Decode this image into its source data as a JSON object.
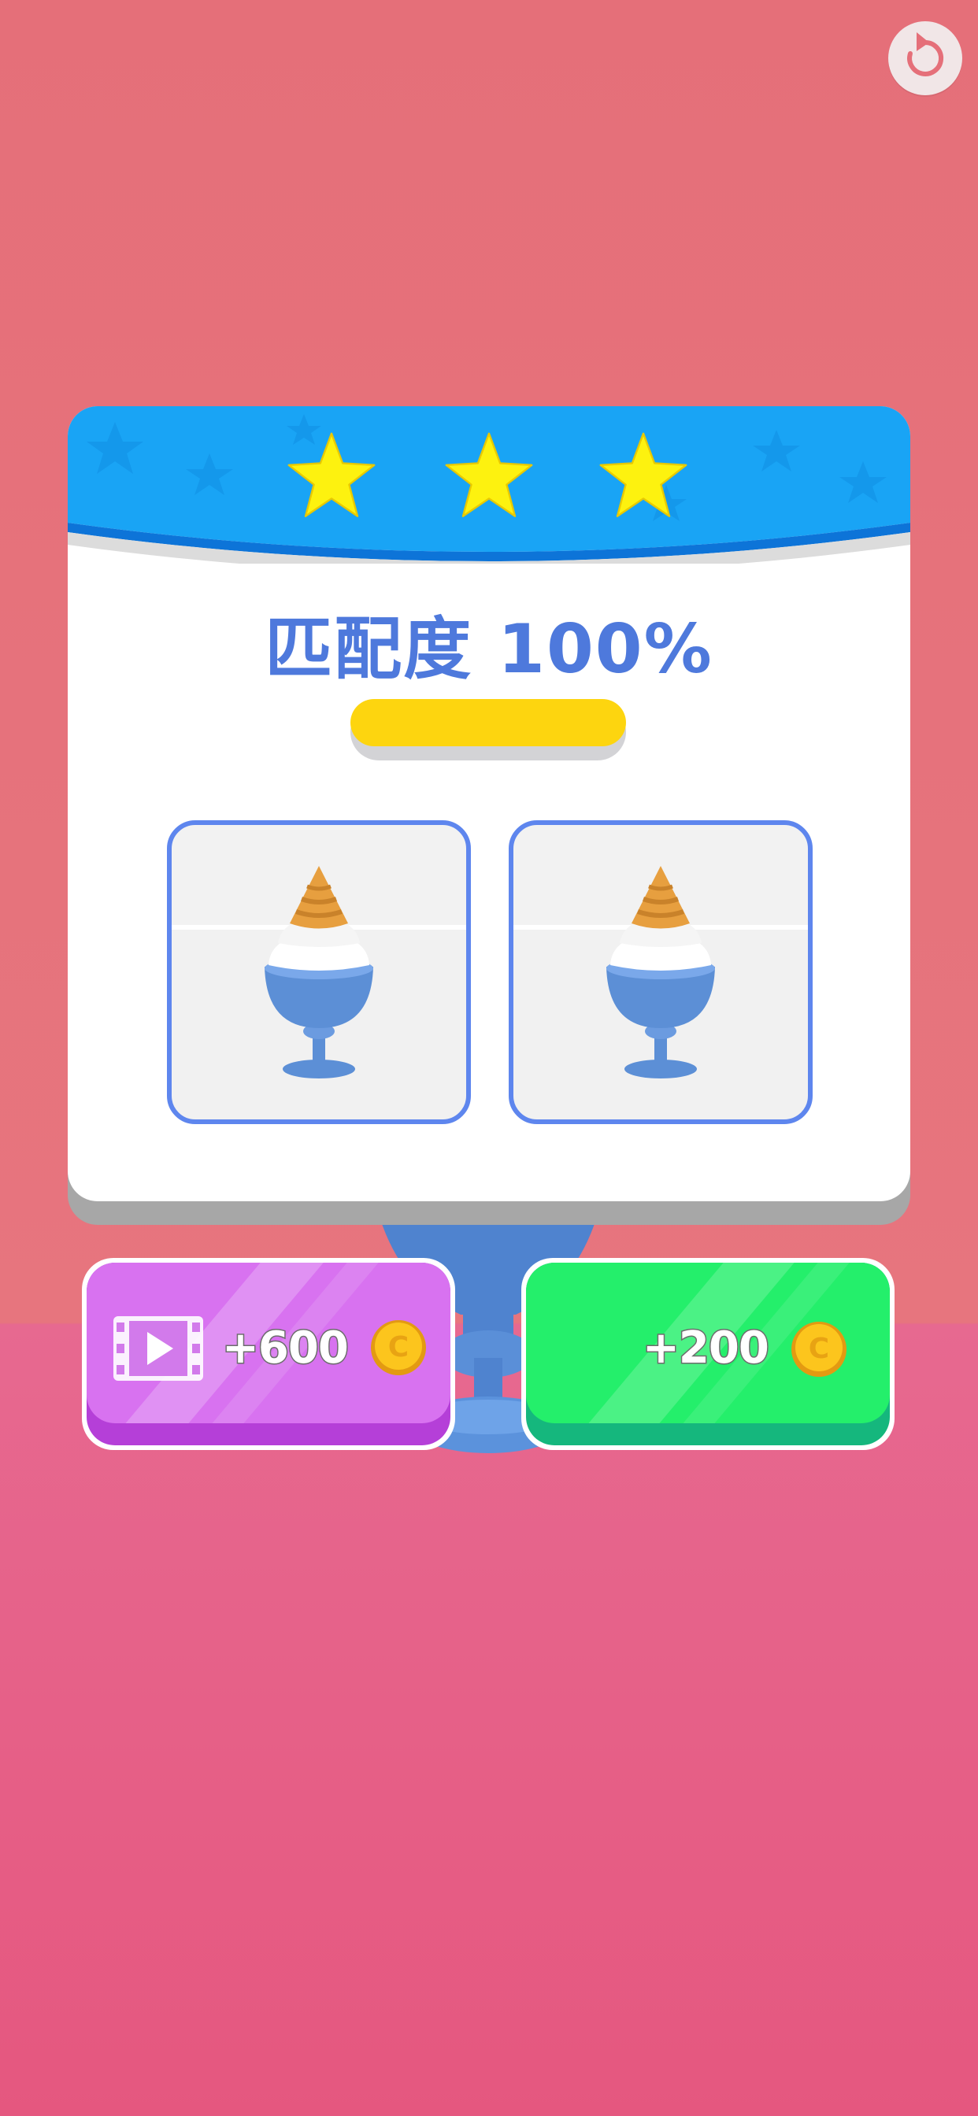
{
  "result": {
    "stars_earned": 3,
    "stars_total": 3,
    "match_label": "匹配度 100%",
    "match_fraction": 1.0
  },
  "comparison": {
    "left_panel": "target-dessert",
    "right_panel": "player-dessert"
  },
  "buttons": {
    "video_reward": {
      "label": "+600",
      "icon": "video-icon",
      "coin_icon": "coin-icon"
    },
    "collect_reward": {
      "label": "+200",
      "coin_icon": "coin-icon"
    }
  },
  "colors": {
    "accent_blue": "#4e79dc",
    "header_blue": "#19a4f5",
    "star_yellow": "#fdf20f",
    "progress_yellow": "#fdd50f",
    "video_button": "#d872f0",
    "collect_button": "#24ef6b"
  },
  "icons": [
    "restart-icon",
    "star-icon",
    "video-icon",
    "coin-icon"
  ]
}
